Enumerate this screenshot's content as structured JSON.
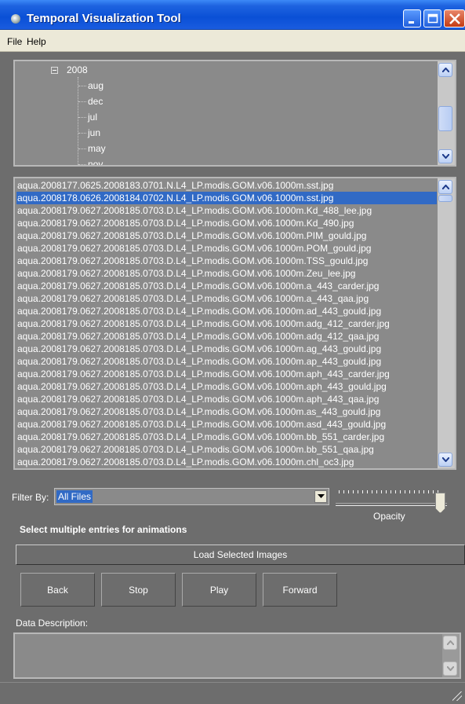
{
  "window": {
    "title": "Temporal Visualization Tool"
  },
  "menu": {
    "file": "File",
    "help": "Help"
  },
  "tree": {
    "year": "2008",
    "months": [
      "aug",
      "dec",
      "jul",
      "jun",
      "may",
      "nov"
    ]
  },
  "files": {
    "selected_index": 1,
    "rows": [
      "aqua.2008177.0625.2008183.0701.N.L4_LP.modis.GOM.v06.1000m.sst.jpg",
      "aqua.2008178.0626.2008184.0702.N.L4_LP.modis.GOM.v06.1000m.sst.jpg",
      "aqua.2008179.0627.2008185.0703.D.L4_LP.modis.GOM.v06.1000m.Kd_488_lee.jpg",
      "aqua.2008179.0627.2008185.0703.D.L4_LP.modis.GOM.v06.1000m.Kd_490.jpg",
      "aqua.2008179.0627.2008185.0703.D.L4_LP.modis.GOM.v06.1000m.PIM_gould.jpg",
      "aqua.2008179.0627.2008185.0703.D.L4_LP.modis.GOM.v06.1000m.POM_gould.jpg",
      "aqua.2008179.0627.2008185.0703.D.L4_LP.modis.GOM.v06.1000m.TSS_gould.jpg",
      "aqua.2008179.0627.2008185.0703.D.L4_LP.modis.GOM.v06.1000m.Zeu_lee.jpg",
      "aqua.2008179.0627.2008185.0703.D.L4_LP.modis.GOM.v06.1000m.a_443_carder.jpg",
      "aqua.2008179.0627.2008185.0703.D.L4_LP.modis.GOM.v06.1000m.a_443_qaa.jpg",
      "aqua.2008179.0627.2008185.0703.D.L4_LP.modis.GOM.v06.1000m.ad_443_gould.jpg",
      "aqua.2008179.0627.2008185.0703.D.L4_LP.modis.GOM.v06.1000m.adg_412_carder.jpg",
      "aqua.2008179.0627.2008185.0703.D.L4_LP.modis.GOM.v06.1000m.adg_412_qaa.jpg",
      "aqua.2008179.0627.2008185.0703.D.L4_LP.modis.GOM.v06.1000m.ag_443_gould.jpg",
      "aqua.2008179.0627.2008185.0703.D.L4_LP.modis.GOM.v06.1000m.ap_443_gould.jpg",
      "aqua.2008179.0627.2008185.0703.D.L4_LP.modis.GOM.v06.1000m.aph_443_carder.jpg",
      "aqua.2008179.0627.2008185.0703.D.L4_LP.modis.GOM.v06.1000m.aph_443_gould.jpg",
      "aqua.2008179.0627.2008185.0703.D.L4_LP.modis.GOM.v06.1000m.aph_443_qaa.jpg",
      "aqua.2008179.0627.2008185.0703.D.L4_LP.modis.GOM.v06.1000m.as_443_gould.jpg",
      "aqua.2008179.0627.2008185.0703.D.L4_LP.modis.GOM.v06.1000m.asd_443_gould.jpg",
      "aqua.2008179.0627.2008185.0703.D.L4_LP.modis.GOM.v06.1000m.bb_551_carder.jpg",
      "aqua.2008179.0627.2008185.0703.D.L4_LP.modis.GOM.v06.1000m.bb_551_qaa.jpg",
      "aqua.2008179.0627.2008185.0703.D.L4_LP.modis.GOM.v06.1000m.chl_oc3.jpg"
    ]
  },
  "filter": {
    "label": "Filter By:",
    "value": "All Files"
  },
  "opacity": {
    "label": "Opacity",
    "level": 1.0
  },
  "hint": "Select multiple entries for animations",
  "load_button": "Load Selected Images",
  "controls": {
    "back": "Back",
    "stop": "Stop",
    "play": "Play",
    "forward": "Forward"
  },
  "description": {
    "label": "Data Description:",
    "text": ""
  },
  "colors": {
    "titlebar": "#0a50d6",
    "selection": "#316ac5",
    "background": "#6d6d6d",
    "panel": "#8a8a8a"
  }
}
